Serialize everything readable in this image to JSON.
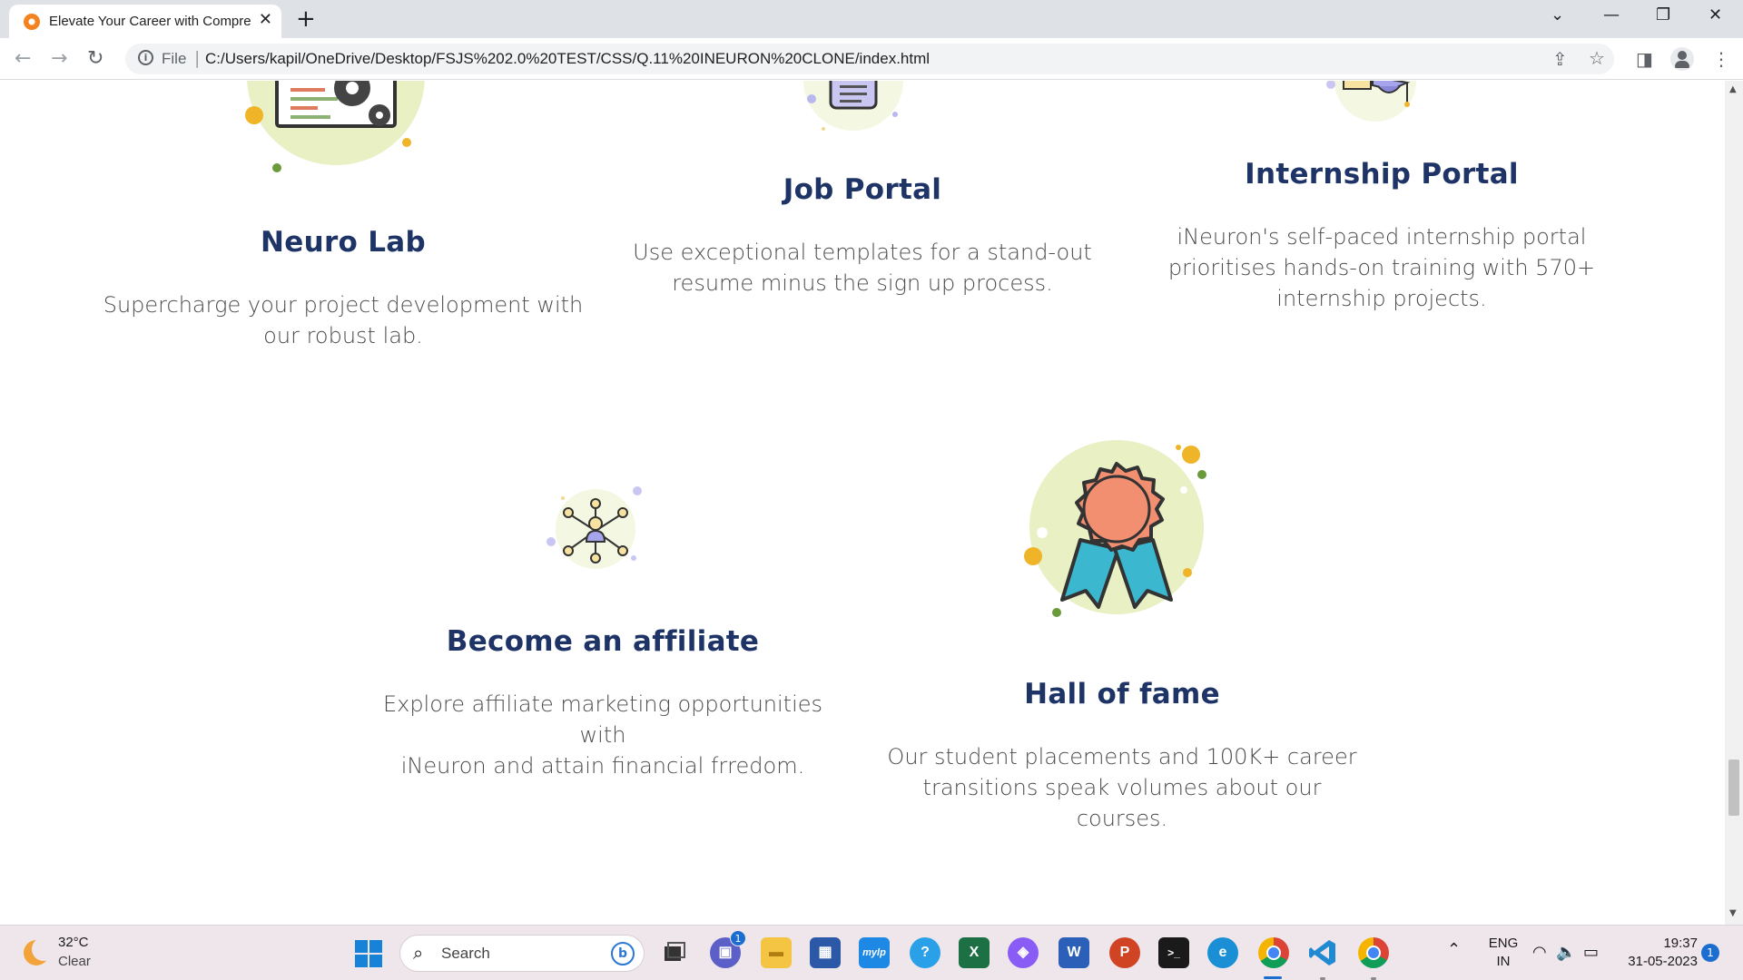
{
  "browser": {
    "tab_title": "Elevate Your Career with Compre",
    "new_tab": "+",
    "url_scheme": "File",
    "url": "C:/Users/kapil/OneDrive/Desktop/FSJS%202.0%20TEST/CSS/Q.11%20INEURON%20CLONE/index.html"
  },
  "cards": {
    "neuro_lab": {
      "title": "Neuro Lab",
      "desc_line1": "Supercharge your project development with",
      "desc_line2": "our robust lab."
    },
    "job_portal": {
      "title": "Job Portal",
      "desc_line1": "Use exceptional templates for a stand-out",
      "desc_line2": "resume minus the sign up process."
    },
    "internship_portal": {
      "title": "Internship Portal",
      "desc_line1": "iNeuron's self-paced internship portal",
      "desc_line2": "prioritises hands-on training with 570+",
      "desc_line3": "internship projects."
    },
    "affiliate": {
      "title": "Become an affiliate",
      "desc_line1": "Explore affiliate marketing opportunities with",
      "desc_line2": "iNeuron and attain financial frredom."
    },
    "hall_of_fame": {
      "title": "Hall of fame",
      "desc_line1": "Our student placements and 100K+ career",
      "desc_line2": "transitions speak volumes about our courses."
    }
  },
  "taskbar": {
    "weather_temp": "32°C",
    "weather_cond": "Clear",
    "search_placeholder": "Search",
    "teams_badge": "1",
    "mylp_label": "mylp",
    "lang_line1": "ENG",
    "lang_line2": "IN",
    "time": "19:37",
    "date": "31-05-2023",
    "notification_count": "1"
  },
  "colors": {
    "heading": "#1f3466",
    "body_text": "#4b4b4b",
    "illustration_bg": "#e8f0c4",
    "accent_yellow": "#f0b429",
    "accent_green": "#6a9a3a",
    "accent_lavender": "#b9b8ee"
  }
}
